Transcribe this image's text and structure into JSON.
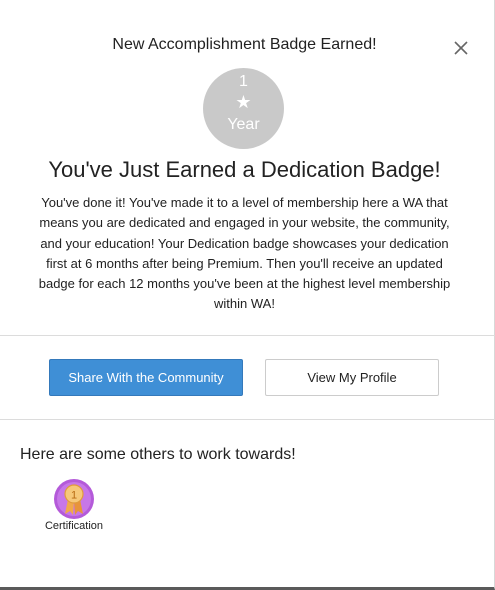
{
  "modal": {
    "header_title": "New Accomplishment Badge Earned!",
    "close_icon": "close-icon"
  },
  "badge": {
    "number": "1",
    "star": "★",
    "unit": "Year",
    "color": "#c9c9c9"
  },
  "main": {
    "title": "You've Just Earned a Dedication Badge!",
    "description": "You've done it! You've made it to a level of membership here a WA that means you are dedicated and engaged in your website, the community, and your education! Your Dedication badge showcases your dedication first at 6 months after being Premium. Then you'll receive an updated badge for each 12 months you've been at the highest level membership within WA!"
  },
  "actions": {
    "share_label": "Share With the Community",
    "profile_label": "View My Profile",
    "share_color": "#3f8fd6"
  },
  "others": {
    "heading": "Here are some others to work towards!",
    "badges": [
      {
        "label": "Certification",
        "number": "1",
        "icon": "certification-ribbon-icon"
      }
    ]
  }
}
